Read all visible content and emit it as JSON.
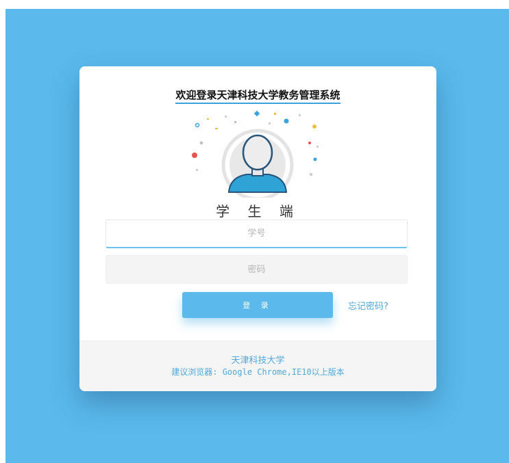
{
  "header": {
    "title": "欢迎登录天津科技大学教务管理系统"
  },
  "role": {
    "label": "学 生 端"
  },
  "form": {
    "student_id_placeholder": "学号",
    "password_placeholder": "密码",
    "login_label": "登 录",
    "forgot_label": "忘记密码?"
  },
  "footer": {
    "school": "天津科技大学",
    "browser_note": "建议浏览器: Google Chrome,IE10以上版本"
  },
  "colors": {
    "background": "#5bb9ec",
    "accent": "#5bb9ec",
    "link": "#4fa9dc"
  },
  "icons": {
    "avatar": "user-avatar-icon"
  }
}
